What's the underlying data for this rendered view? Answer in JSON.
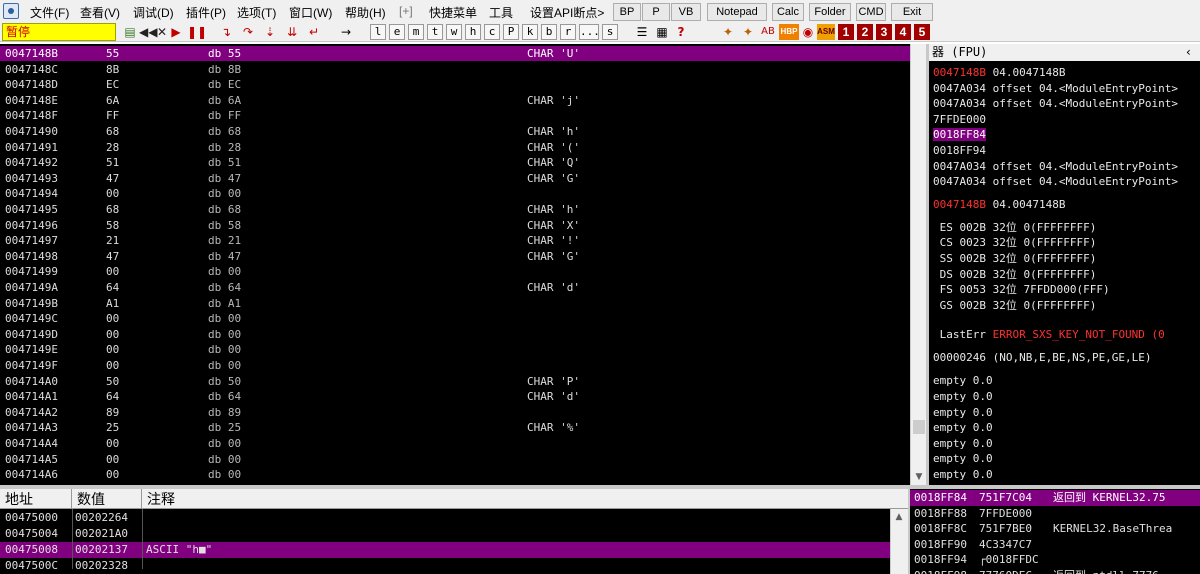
{
  "menubar": {
    "items": [
      "文件(F)",
      "查看(V)",
      "调试(D)",
      "插件(P)",
      "选项(T)",
      "窗口(W)",
      "帮助(H)",
      "[+]",
      "快捷菜单",
      "工具",
      "设置API断点>"
    ],
    "buttons": [
      "BP",
      "P",
      "VB",
      "Notepad",
      "Calc",
      "Folder",
      "CMD",
      "Exit"
    ]
  },
  "toolbar": {
    "status": "暂停",
    "letters": [
      "l",
      "e",
      "m",
      "t",
      "w",
      "h",
      "c",
      "P",
      "k",
      "b",
      "r",
      "...",
      "s"
    ],
    "plugins": [
      "HBP",
      "ASM"
    ],
    "numbers": [
      "1",
      "2",
      "3",
      "4",
      "5"
    ]
  },
  "cpu": {
    "rows": [
      {
        "addr": "0047148B",
        "hex": "55",
        "dis": "db 55",
        "com": "CHAR 'U'",
        "sel": true
      },
      {
        "addr": "0047148C",
        "hex": "8B",
        "dis": "db 8B",
        "com": ""
      },
      {
        "addr": "0047148D",
        "hex": "EC",
        "dis": "db EC",
        "com": ""
      },
      {
        "addr": "0047148E",
        "hex": "6A",
        "dis": "db 6A",
        "com": "CHAR 'j'"
      },
      {
        "addr": "0047148F",
        "hex": "FF",
        "dis": "db FF",
        "com": ""
      },
      {
        "addr": "00471490",
        "hex": "68",
        "dis": "db 68",
        "com": "CHAR 'h'"
      },
      {
        "addr": "00471491",
        "hex": "28",
        "dis": "db 28",
        "com": "CHAR '('"
      },
      {
        "addr": "00471492",
        "hex": "51",
        "dis": "db 51",
        "com": "CHAR 'Q'"
      },
      {
        "addr": "00471493",
        "hex": "47",
        "dis": "db 47",
        "com": "CHAR 'G'"
      },
      {
        "addr": "00471494",
        "hex": "00",
        "dis": "db 00",
        "com": ""
      },
      {
        "addr": "00471495",
        "hex": "68",
        "dis": "db 68",
        "com": "CHAR 'h'"
      },
      {
        "addr": "00471496",
        "hex": "58",
        "dis": "db 58",
        "com": "CHAR 'X'"
      },
      {
        "addr": "00471497",
        "hex": "21",
        "dis": "db 21",
        "com": "CHAR '!'"
      },
      {
        "addr": "00471498",
        "hex": "47",
        "dis": "db 47",
        "com": "CHAR 'G'"
      },
      {
        "addr": "00471499",
        "hex": "00",
        "dis": "db 00",
        "com": ""
      },
      {
        "addr": "0047149A",
        "hex": "64",
        "dis": "db 64",
        "com": "CHAR 'd'"
      },
      {
        "addr": "0047149B",
        "hex": "A1",
        "dis": "db A1",
        "com": ""
      },
      {
        "addr": "0047149C",
        "hex": "00",
        "dis": "db 00",
        "com": ""
      },
      {
        "addr": "0047149D",
        "hex": "00",
        "dis": "db 00",
        "com": ""
      },
      {
        "addr": "0047149E",
        "hex": "00",
        "dis": "db 00",
        "com": ""
      },
      {
        "addr": "0047149F",
        "hex": "00",
        "dis": "db 00",
        "com": ""
      },
      {
        "addr": "004714A0",
        "hex": "50",
        "dis": "db 50",
        "com": "CHAR 'P'"
      },
      {
        "addr": "004714A1",
        "hex": "64",
        "dis": "db 64",
        "com": "CHAR 'd'"
      },
      {
        "addr": "004714A2",
        "hex": "89",
        "dis": "db 89",
        "com": ""
      },
      {
        "addr": "004714A3",
        "hex": "25",
        "dis": "db 25",
        "com": "CHAR '%'"
      },
      {
        "addr": "004714A4",
        "hex": "00",
        "dis": "db 00",
        "com": ""
      },
      {
        "addr": "004714A5",
        "hex": "00",
        "dis": "db 00",
        "com": ""
      },
      {
        "addr": "004714A6",
        "hex": "00",
        "dis": "db 00",
        "com": ""
      }
    ]
  },
  "registers": {
    "header": "器 (FPU)",
    "stack_lines": [
      {
        "a": "0047148B",
        "b": " 04.0047148B",
        "red": true
      },
      {
        "a": "0047A034",
        "b": " offset 04.<ModuleEntryPoint>"
      },
      {
        "a": "0047A034",
        "b": " offset 04.<ModuleEntryPoint>"
      },
      {
        "a": "7FFDE000",
        "b": ""
      },
      {
        "a": "0018FF84",
        "b": "",
        "hl": true
      },
      {
        "a": "0018FF94",
        "b": ""
      },
      {
        "a": "0047A034",
        "b": " offset 04.<ModuleEntryPoint>"
      },
      {
        "a": "0047A034",
        "b": " offset 04.<ModuleEntryPoint>"
      }
    ],
    "eip": {
      "a": "0047148B",
      "b": " 04.0047148B"
    },
    "segments": [
      " ES 002B 32位 0(FFFFFFFF)",
      " CS 0023 32位 0(FFFFFFFF)",
      " SS 002B 32位 0(FFFFFFFF)",
      " DS 002B 32位 0(FFFFFFFF)",
      " FS 0053 32位 7FFDD000(FFF)",
      " GS 002B 32位 0(FFFFFFFF)"
    ],
    "lasterr_label": " LastErr ",
    "lasterr_value": "ERROR_SXS_KEY_NOT_FOUND (0",
    "flags": "00000246 (NO,NB,E,BE,NS,PE,GE,LE)",
    "fpu": [
      "empty 0.0",
      "empty 0.0",
      "empty 0.0",
      "empty 0.0",
      "empty 0.0",
      "empty 0.0",
      "empty 0.0"
    ]
  },
  "dump": {
    "headers": [
      "地址",
      "数值",
      "注释"
    ],
    "rows": [
      {
        "addr": "00475000",
        "val": "00202264",
        "com": ""
      },
      {
        "addr": "00475004",
        "val": "002021A0",
        "com": ""
      },
      {
        "addr": "00475008",
        "val": "00202137",
        "com": "ASCII \"h■\"",
        "sel": true
      },
      {
        "addr": "0047500C",
        "val": "00202328",
        "com": ""
      }
    ]
  },
  "stack": {
    "rows": [
      {
        "addr": "0018FF84",
        "val": "751F7C04",
        "com": "返回到 KERNEL32.75",
        "sel": true
      },
      {
        "addr": "0018FF88",
        "val": "7FFDE000",
        "com": ""
      },
      {
        "addr": "0018FF8C",
        "val": "751F7BE0",
        "com": "KERNEL32.BaseThrea"
      },
      {
        "addr": "0018FF90",
        "val": "4C3347C7",
        "com": ""
      },
      {
        "addr": "0018FF94",
        "val": "┌0018FFDC",
        "com": ""
      },
      {
        "addr": "0018FF98",
        "val": "77760DEC",
        "com": "返回到 ntdll.7776"
      }
    ]
  },
  "colors": {
    "selection": "#800080",
    "pane_bg": "#000000",
    "status_bg": "#ffff00",
    "error_text": "#ff3030"
  }
}
